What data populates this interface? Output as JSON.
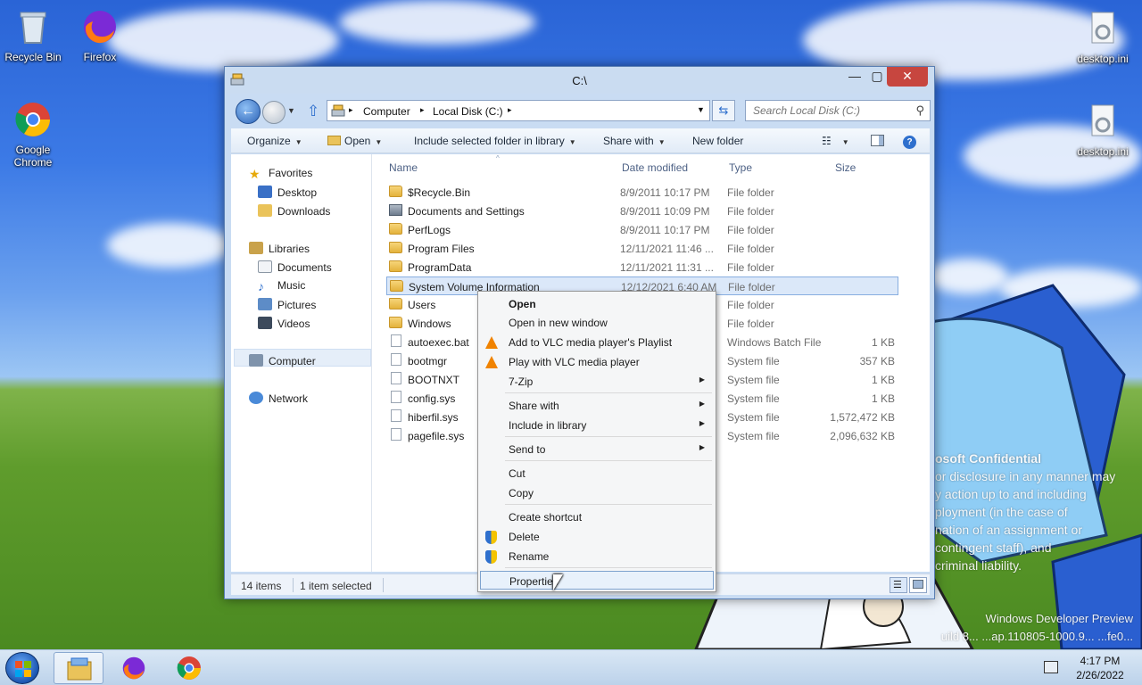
{
  "desktop": {
    "icons": [
      {
        "label": "Recycle Bin"
      },
      {
        "label": "Firefox"
      },
      {
        "label": "Google Chrome"
      },
      {
        "label": "desktop.ini"
      },
      {
        "label": "desktop.ini"
      }
    ],
    "watermark": {
      "lines": [
        "osoft Confidential",
        "or disclosure in any manner may",
        "y action up to and including",
        "ployment (in the case of",
        "nation of an assignment or",
        "contingent staff), and",
        "criminal liability."
      ],
      "build_lines": [
        "Windows Developer Preview",
        "uild 8... ...ap.110805-1000.9... ...fe0..."
      ]
    }
  },
  "window": {
    "title": "C:\\",
    "buttons": {
      "minimize": "—",
      "maximize": "▢",
      "close": "✕"
    },
    "address": {
      "segments": [
        "Computer",
        "Local Disk (C:)"
      ],
      "separator": "▸"
    },
    "search_placeholder": "Search Local Disk (C:)",
    "toolbar": {
      "organize": "Organize",
      "open": "Open",
      "include": "Include selected folder in library",
      "share": "Share with",
      "new_folder": "New folder",
      "help": "?"
    },
    "nav": {
      "favorites": "Favorites",
      "desktop": "Desktop",
      "downloads": "Downloads",
      "libraries": "Libraries",
      "documents": "Documents",
      "music": "Music",
      "pictures": "Pictures",
      "videos": "Videos",
      "computer": "Computer",
      "network": "Network"
    },
    "columns": {
      "name": "Name",
      "date": "Date modified",
      "type": "Type",
      "size": "Size"
    },
    "files": [
      {
        "name": "$Recycle.Bin",
        "date": "8/9/2011 10:17 PM",
        "type": "File folder",
        "size": "",
        "kind": "folder"
      },
      {
        "name": "Documents and Settings",
        "date": "8/9/2011 10:09 PM",
        "type": "File folder",
        "size": "",
        "kind": "link"
      },
      {
        "name": "PerfLogs",
        "date": "8/9/2011 10:17 PM",
        "type": "File folder",
        "size": "",
        "kind": "folder"
      },
      {
        "name": "Program Files",
        "date": "12/11/2021 11:46 ...",
        "type": "File folder",
        "size": "",
        "kind": "folder"
      },
      {
        "name": "ProgramData",
        "date": "12/11/2021 11:31 ...",
        "type": "File folder",
        "size": "",
        "kind": "folder"
      },
      {
        "name": "System Volume Information",
        "date": "12/12/2021 6:40 AM",
        "type": "File folder",
        "size": "",
        "kind": "folder",
        "selected": true
      },
      {
        "name": "Users",
        "date": "",
        "type": "File folder",
        "size": "",
        "kind": "folder"
      },
      {
        "name": "Windows",
        "date": "",
        "type": "File folder",
        "size": "",
        "kind": "folder"
      },
      {
        "name": "autoexec.bat",
        "date": "",
        "type": "Windows Batch File",
        "size": "1 KB",
        "kind": "file"
      },
      {
        "name": "bootmgr",
        "date": "",
        "type": "System file",
        "size": "357 KB",
        "kind": "file"
      },
      {
        "name": "BOOTNXT",
        "date": "",
        "type": "System file",
        "size": "1 KB",
        "kind": "file"
      },
      {
        "name": "config.sys",
        "date": "",
        "type": "System file",
        "size": "1 KB",
        "kind": "file"
      },
      {
        "name": "hiberfil.sys",
        "date": "",
        "type": "System file",
        "size": "1,572,472 KB",
        "kind": "file"
      },
      {
        "name": "pagefile.sys",
        "date": "",
        "type": "System file",
        "size": "2,096,632 KB",
        "kind": "file"
      }
    ],
    "status": {
      "count": "14 items",
      "selected": "1 item selected"
    }
  },
  "context_menu": {
    "items": [
      {
        "label": "Open",
        "bold": true
      },
      {
        "label": "Open in new window"
      },
      {
        "label": "Add to VLC media player's Playlist",
        "icon": "vlc-cone-icon"
      },
      {
        "label": "Play with VLC media player",
        "icon": "vlc-cone-icon"
      },
      {
        "label": "7-Zip",
        "submenu": true
      },
      {
        "label": "Share with",
        "submenu": true
      },
      {
        "label": "Include in library",
        "submenu": true
      },
      {
        "label": "Send to",
        "submenu": true
      },
      {
        "label": "Cut"
      },
      {
        "label": "Copy"
      },
      {
        "label": "Create shortcut"
      },
      {
        "label": "Delete",
        "icon": "uac-shield-icon"
      },
      {
        "label": "Rename",
        "icon": "uac-shield-icon"
      },
      {
        "label": "Properties",
        "highlighted": true
      }
    ]
  },
  "taskbar": {
    "time": "4:17 PM",
    "date": "2/26/2022"
  }
}
